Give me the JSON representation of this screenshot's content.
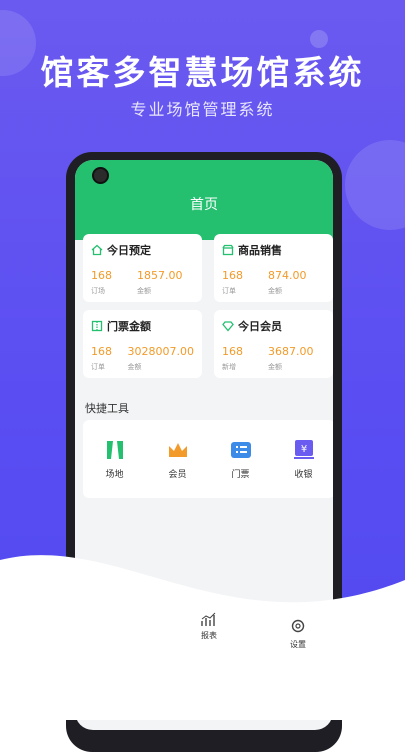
{
  "header": {
    "title": "馆客多智慧场馆系统",
    "subtitle": "专业场馆管理系统"
  },
  "app": {
    "page_title": "首页",
    "accent": "#24c070",
    "value_color": "#f29b2a"
  },
  "cards": [
    {
      "title": "今日预定",
      "icon": "home-icon",
      "v1": "168",
      "l1": "订场",
      "v2": "1857.00",
      "l2": "金额"
    },
    {
      "title": "商品销售",
      "icon": "shop-icon",
      "v1": "168",
      "l1": "订单",
      "v2": "874.00",
      "l2": "金额"
    },
    {
      "title": "门票金额",
      "icon": "ticket-icon",
      "v1": "168",
      "l1": "订单",
      "v2": "3028007.00",
      "l2": "金额"
    },
    {
      "title": "今日会员",
      "icon": "diamond-icon",
      "v1": "168",
      "l1": "新增",
      "v2": "3687.00",
      "l2": "金额"
    }
  ],
  "tools": {
    "title": "快捷工具",
    "items": [
      {
        "label": "场地",
        "icon": "venue-icon",
        "color": "#24c070"
      },
      {
        "label": "会员",
        "icon": "crown-icon",
        "color": "#f29b2a"
      },
      {
        "label": "门票",
        "icon": "ticket-list-icon",
        "color": "#3d8be8"
      },
      {
        "label": "收银",
        "icon": "cashier-icon",
        "color": "#6a5cf0"
      }
    ]
  },
  "nav": {
    "items": [
      {
        "label": "报表",
        "icon": "chart-icon"
      },
      {
        "label": "设置",
        "icon": "gear-icon"
      }
    ]
  }
}
